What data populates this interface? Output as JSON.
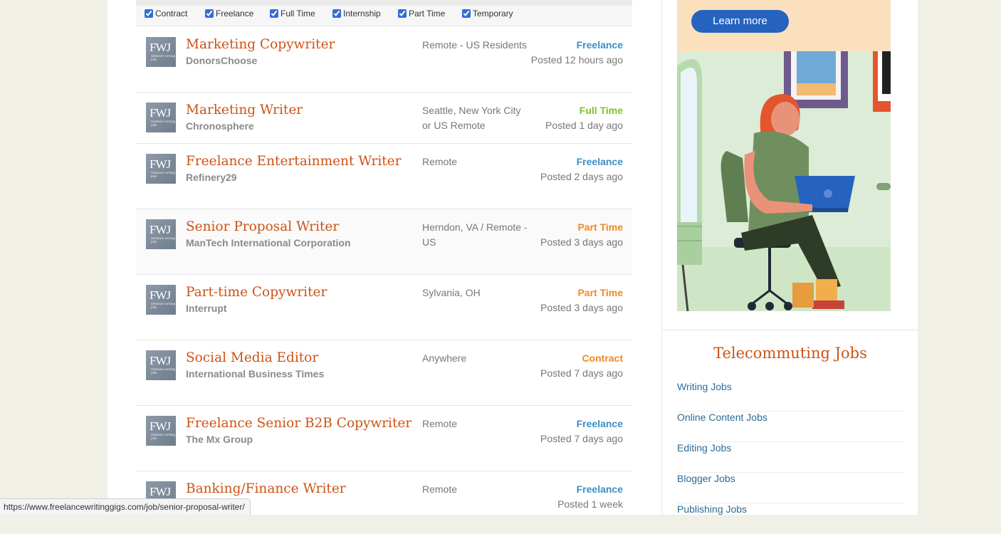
{
  "filters": [
    {
      "label": "Contract",
      "checked": true
    },
    {
      "label": "Freelance",
      "checked": true
    },
    {
      "label": "Full Time",
      "checked": true
    },
    {
      "label": "Internship",
      "checked": true
    },
    {
      "label": "Part Time",
      "checked": true
    },
    {
      "label": "Temporary",
      "checked": true
    }
  ],
  "logo": {
    "big": "FWJ",
    "small": "freelance writing jobs"
  },
  "colors": {
    "freelance": "#3a8fc4",
    "full_time": "#7cc424",
    "part_time": "#f08a24",
    "contract": "#f08a24",
    "title": "#cc5316"
  },
  "jobs": [
    {
      "title": "Marketing Copywriter",
      "company": "DonorsChoose",
      "location": "Remote - US Residents",
      "type": "Freelance",
      "posted": "Posted 12 hours ago"
    },
    {
      "title": "Marketing Writer",
      "company": "Chronosphere",
      "location": "Seattle, New York City or US Remote",
      "type": "Full Time",
      "posted": "Posted 1 day ago"
    },
    {
      "title": "Freelance Entertainment Writer",
      "company": "Refinery29",
      "location": "Remote",
      "type": "Freelance",
      "posted": "Posted 2 days ago"
    },
    {
      "title": "Senior Proposal Writer",
      "company": "ManTech International Corporation",
      "location": "Herndon, VA / Remote - US",
      "type": "Part Time",
      "posted": "Posted 3 days ago"
    },
    {
      "title": "Part-time Copywriter",
      "company": "Interrupt",
      "location": "Sylvania, OH",
      "type": "Part Time",
      "posted": "Posted 3 days ago"
    },
    {
      "title": "Social Media Editor",
      "company": "International Business Times",
      "location": "Anywhere",
      "type": "Contract",
      "posted": "Posted 7 days ago"
    },
    {
      "title": "Freelance Senior B2B Copywriter",
      "company": "The Mx Group",
      "location": "Remote",
      "type": "Freelance",
      "posted": "Posted 7 days ago"
    },
    {
      "title": "Banking/Finance Writer",
      "company": "",
      "location": "Remote",
      "type": "Freelance",
      "posted": "Posted 1 week"
    }
  ],
  "sidebar": {
    "ad_button": "Learn more",
    "heading": "Telecommuting Jobs",
    "links": [
      "Writing Jobs",
      "Online Content Jobs",
      "Editing Jobs",
      "Blogger Jobs",
      "Publishing Jobs"
    ]
  },
  "status_url": "https://www.freelancewritinggigs.com/job/senior-proposal-writer/"
}
